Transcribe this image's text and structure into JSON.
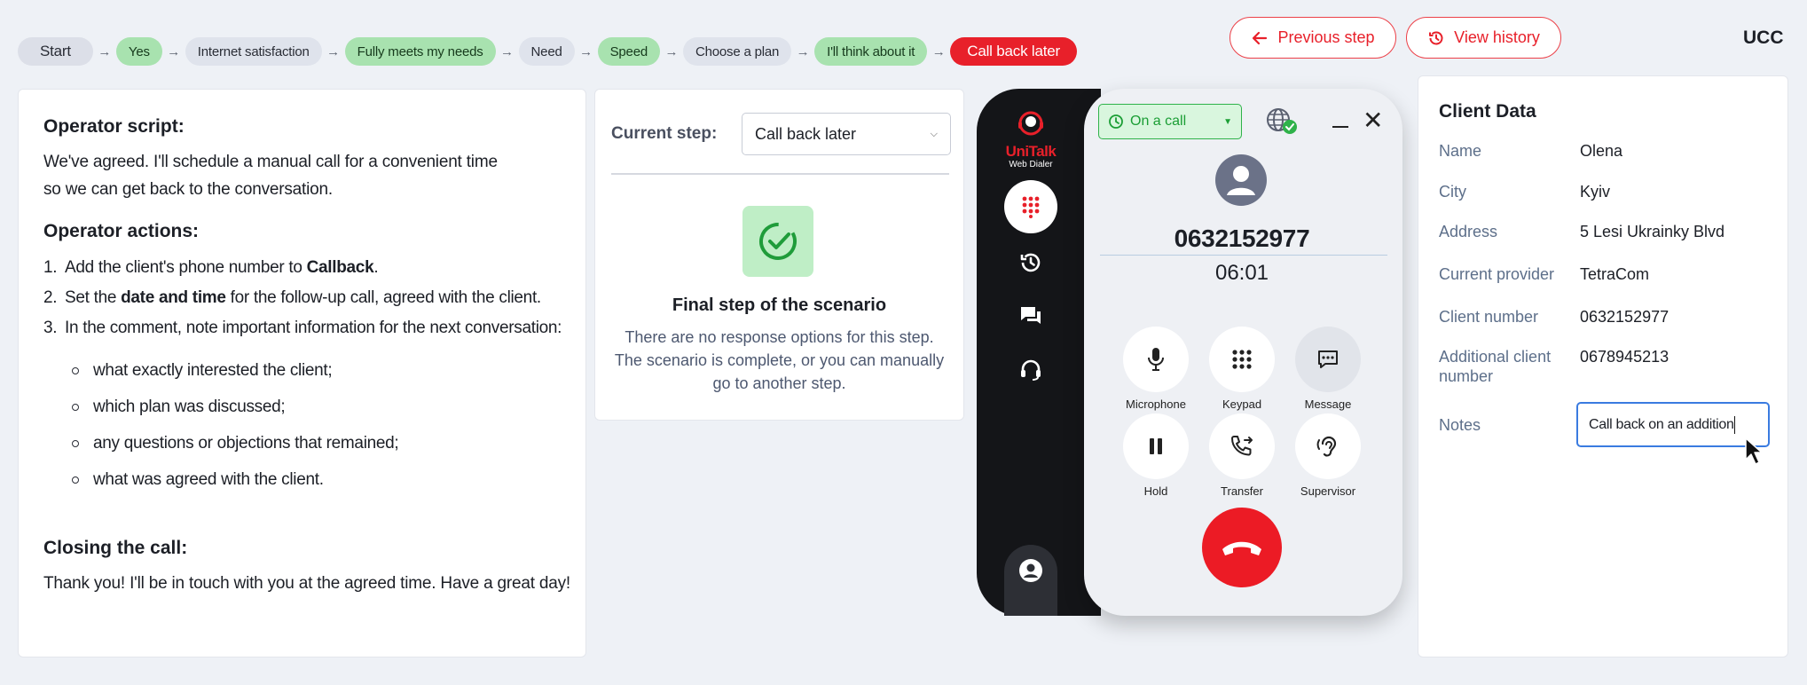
{
  "breadcrumb": [
    {
      "label": "Start",
      "style": "start"
    },
    {
      "label": "Yes",
      "style": "green"
    },
    {
      "label": "Internet satisfaction",
      "style": "grey"
    },
    {
      "label": "Fully meets my needs",
      "style": "green"
    },
    {
      "label": "Need",
      "style": "grey"
    },
    {
      "label": "Speed",
      "style": "green"
    },
    {
      "label": "Choose a plan",
      "style": "grey"
    },
    {
      "label": "I'll think about it",
      "style": "green"
    },
    {
      "label": "Call back later",
      "style": "red"
    }
  ],
  "header": {
    "previous_step": "Previous step",
    "view_history": "View history",
    "brand": "UCC"
  },
  "script": {
    "script_title": "Operator script:",
    "script_line1": "We've agreed. I'll schedule a manual call for a convenient time",
    "script_line2": "so we can get back to the conversation.",
    "actions_title": "Operator actions:",
    "actions": [
      {
        "num": "1.",
        "pre": "Add the client's phone number to ",
        "bold": "Callback",
        "post": "."
      },
      {
        "num": "2.",
        "pre": "Set the ",
        "bold": "date and time",
        "post": " for the follow-up call, agreed with the client."
      },
      {
        "num": "3.",
        "pre": "In the comment, note important information for the next conversation:",
        "bold": "",
        "post": ""
      }
    ],
    "bullets": [
      "what exactly interested the client;",
      "which plan was discussed;",
      "any questions or objections that remained;",
      "what was agreed with the client."
    ],
    "closing_title": "Closing the call:",
    "closing_text": "Thank you! I'll be in touch with you at the agreed time. Have a great day!"
  },
  "step_panel": {
    "label": "Current step:",
    "selected": "Call back later",
    "final_title": "Final step of the scenario",
    "final_line1": "There are no response options for this step.",
    "final_line2": "The scenario is complete, or you can manually",
    "final_line3": "go to another step."
  },
  "dialer": {
    "logo_name": "UniTalk",
    "logo_sub": "Web Dialer",
    "status": "On a call",
    "phone": "0632152977",
    "timer": "06:01",
    "controls": [
      "Microphone",
      "Keypad",
      "Message",
      "Hold",
      "Transfer",
      "Supervisor"
    ]
  },
  "client": {
    "title": "Client Data",
    "fields": [
      {
        "key": "Name",
        "value": "Olena"
      },
      {
        "key": "City",
        "value": "Kyiv"
      },
      {
        "key": "Address",
        "value": "5 Lesi Ukrainky Blvd"
      },
      {
        "key": "Current provider",
        "value": "TetraCom"
      },
      {
        "key": "Client number",
        "value": "0632152977"
      },
      {
        "key": "Additional client number",
        "value": "0678945213"
      }
    ],
    "notes_label": "Notes",
    "notes_value": "Call back on an addition"
  },
  "colors": {
    "accent_red": "#e8202a",
    "success_green": "#2fb24a",
    "crumb_green": "#a8e2af"
  }
}
